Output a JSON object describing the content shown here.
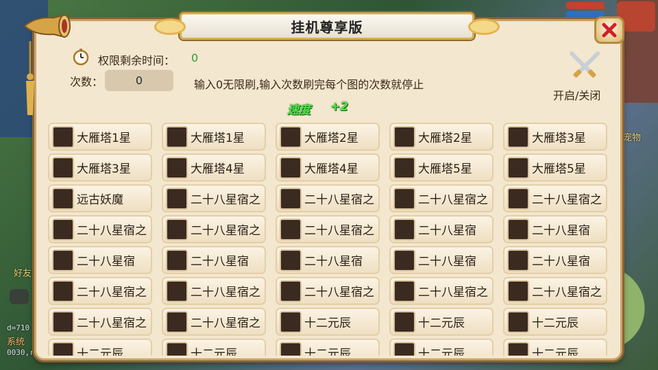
{
  "window": {
    "title": "挂机尊享版"
  },
  "status": {
    "time_label": "权限剩余时间：",
    "time_value": "0",
    "count_label": "次数：",
    "count_value": "0",
    "hint": "输入0无限刷,输入次数刷完每个图的次数就停止",
    "speed_label": "速度",
    "speed_value": "+2",
    "toggle_label": "开启/关闭"
  },
  "background": {
    "pet_label": "宠物",
    "friend_label": "好友",
    "system_label": "系统",
    "id_text": "d=710",
    "coord_text": "0030,r"
  },
  "dungeons": [
    "大雁塔1星",
    "大雁塔1星",
    "大雁塔2星",
    "大雁塔2星",
    "大雁塔3星",
    "大雁塔3星",
    "大雁塔4星",
    "大雁塔4星",
    "大雁塔5星",
    "大雁塔5星",
    "远古妖魔",
    "二十八星宿之",
    "二十八星宿之",
    "二十八星宿之",
    "二十八星宿之",
    "二十八星宿之",
    "二十八星宿之",
    "二十八星宿之",
    "二十八星宿",
    "二十八星宿",
    "二十八星宿",
    "二十八星宿",
    "二十八星宿",
    "二十八星宿",
    "二十八星宿",
    "二十八星宿之",
    "二十八星宿之",
    "二十八星宿之",
    "二十八星宿之",
    "二十八星宿之",
    "二十八星宿之",
    "二十八星宿之",
    "十二元辰",
    "十二元辰",
    "十二元辰",
    "十二元辰",
    "十二元辰",
    "十二元辰",
    "十二元辰",
    "十二元辰"
  ],
  "colors": {
    "panel_bg": "#f4e7cf",
    "speed_green": "#4fe24a",
    "value_green": "#2e9a2e",
    "close_red": "#d0202a"
  }
}
